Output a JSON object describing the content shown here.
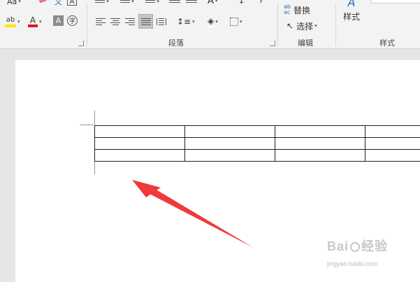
{
  "ribbon": {
    "font_group": {
      "font_size_label": "Aa",
      "phonetic_label": "文",
      "char_border_label": "A",
      "shading_label": "A",
      "enclose_label": "字",
      "highlight_label": "ab",
      "font_color_label": "A"
    },
    "paragraph_group": {
      "label": "段落"
    },
    "edit_group": {
      "label": "编辑",
      "replace_label": "替换",
      "replace_icon_text": "ab ac",
      "select_label": "选择"
    },
    "styles_group": {
      "label": "样式",
      "button_label": "样式"
    },
    "colors": {
      "highlight": "#ffe500",
      "font_color": "#e81123"
    }
  },
  "document": {
    "table": {
      "rows": 3,
      "columns": 4,
      "cells": [
        [
          "",
          "",
          "",
          ""
        ],
        [
          "",
          "",
          "",
          ""
        ],
        [
          "",
          "",
          "",
          ""
        ]
      ]
    },
    "annotation_color": "#f0393b"
  },
  "watermark": {
    "brand": "Bai",
    "brand_suffix": "经验",
    "url": "jingyan.baidu.com"
  }
}
